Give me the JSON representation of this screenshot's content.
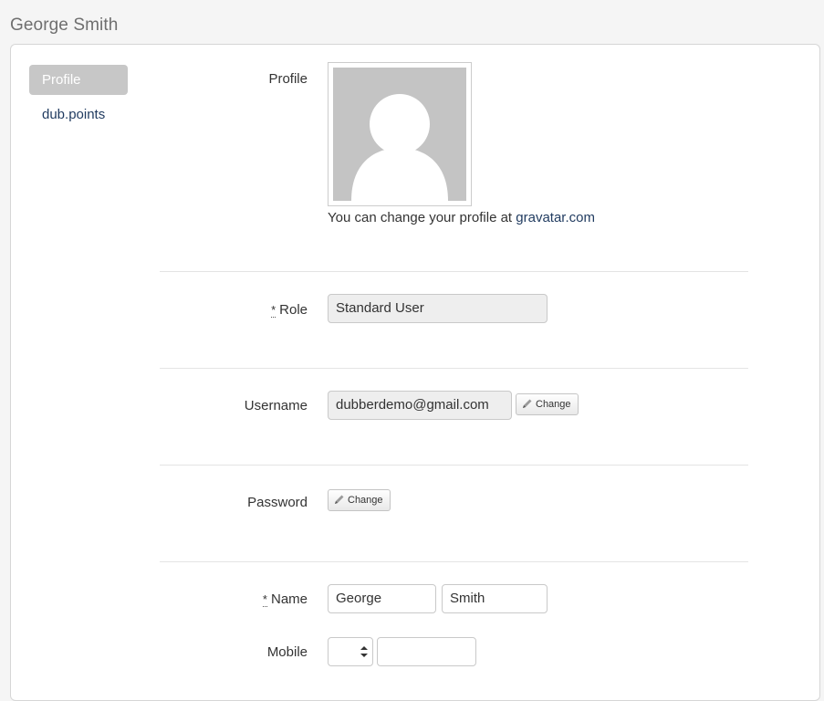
{
  "header": {
    "title": "George Smith"
  },
  "sidebar": {
    "items": [
      {
        "label": "Profile"
      },
      {
        "label": "dub.points"
      }
    ]
  },
  "profile": {
    "profile_label": "Profile",
    "gravatar_text": "You can change your profile at ",
    "gravatar_link": "gravatar.com"
  },
  "role": {
    "required_mark": "*",
    "label": "Role",
    "value": "Standard User"
  },
  "username": {
    "label": "Username",
    "value": "dubberdemo@gmail.com",
    "change_label": "Change"
  },
  "password": {
    "label": "Password",
    "change_label": "Change"
  },
  "name": {
    "required_mark": "*",
    "label": "Name",
    "first": "George",
    "last": "Smith"
  },
  "mobile": {
    "label": "Mobile",
    "country_code": "",
    "number": ""
  }
}
